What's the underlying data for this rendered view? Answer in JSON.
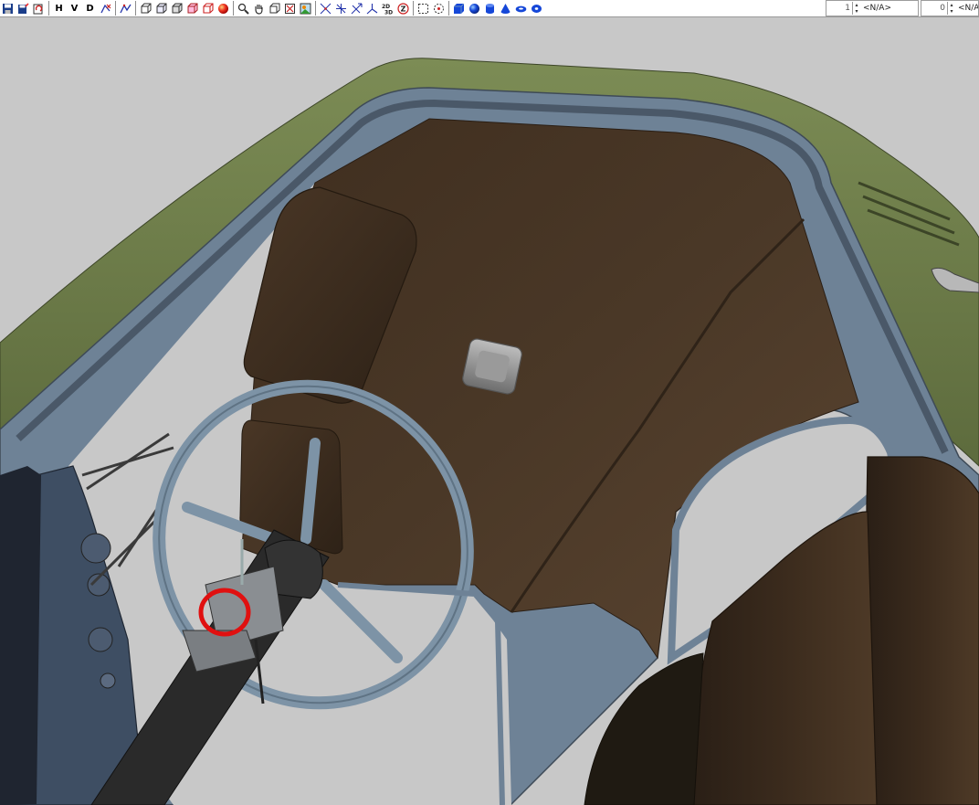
{
  "toolbar": {
    "buttons": [
      {
        "name": "save-icon",
        "label": ""
      },
      {
        "name": "save-as-icon",
        "label": ""
      },
      {
        "name": "reload-icon",
        "label": ""
      },
      {
        "name": "horizontal-view-button",
        "label": "H"
      },
      {
        "name": "vertical-view-button",
        "label": "V"
      },
      {
        "name": "depth-view-button",
        "label": "D"
      },
      {
        "name": "transform-icon",
        "label": ""
      },
      {
        "name": "path-icon",
        "label": ""
      },
      {
        "name": "wire-cube-icon",
        "label": ""
      },
      {
        "name": "cube-outline-icon",
        "label": ""
      },
      {
        "name": "box-icon",
        "label": ""
      },
      {
        "name": "cube-shaded-icon",
        "label": ""
      },
      {
        "name": "cube-red-icon",
        "label": ""
      },
      {
        "name": "sphere-red-icon",
        "label": ""
      },
      {
        "name": "zoom-icon",
        "label": ""
      },
      {
        "name": "pan-hand-icon",
        "label": ""
      },
      {
        "name": "frame-icon",
        "label": ""
      },
      {
        "name": "selection-frame-icon",
        "label": ""
      },
      {
        "name": "image-icon",
        "label": ""
      },
      {
        "name": "axes-xz-icon",
        "label": ""
      },
      {
        "name": "axes-xy-icon",
        "label": ""
      },
      {
        "name": "axes-rotate-icon",
        "label": ""
      },
      {
        "name": "axes-3d-icon",
        "label": ""
      },
      {
        "name": "2d-3d-toggle-icon",
        "label": ""
      },
      {
        "name": "rotate-z-icon",
        "label": ""
      },
      {
        "name": "marquee-select-icon",
        "label": ""
      },
      {
        "name": "center-target-icon",
        "label": ""
      },
      {
        "name": "create-cube-icon",
        "label": ""
      },
      {
        "name": "create-sphere-icon",
        "label": ""
      },
      {
        "name": "create-cylinder-icon",
        "label": ""
      },
      {
        "name": "create-cone-icon",
        "label": ""
      },
      {
        "name": "create-torus-icon",
        "label": ""
      },
      {
        "name": "create-disc-icon",
        "label": ""
      }
    ],
    "field1": {
      "value": "1",
      "selection": "<N/A>"
    },
    "field2": {
      "value": "0",
      "selection": "<N/A>"
    }
  },
  "colors": {
    "background": "#c8c8c8",
    "cab_green": "#6b7a48",
    "frame_blue": "#6e8296",
    "interior_brown": "#4a3826",
    "steering_wheel": "#7d93a6",
    "highlight_circle": "#e01010"
  }
}
